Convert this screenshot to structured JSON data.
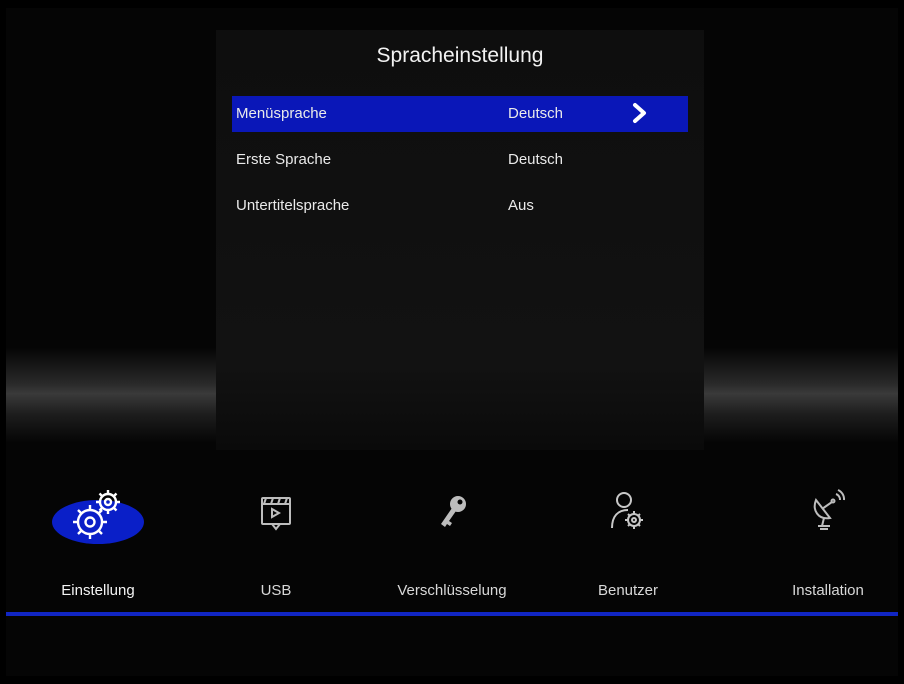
{
  "dialog": {
    "title": "Spracheinstellung",
    "rows": [
      {
        "label": "Menüsprache",
        "value": "Deutsch",
        "selected": true
      },
      {
        "label": "Erste Sprache",
        "value": "Deutsch",
        "selected": false
      },
      {
        "label": "Untertitelsprache",
        "value": "Aus",
        "selected": false
      }
    ]
  },
  "menu": {
    "items": [
      {
        "label": "Einstellung",
        "icon": "gears-icon",
        "active": true
      },
      {
        "label": "USB",
        "icon": "usb-media-icon",
        "active": false
      },
      {
        "label": "Verschlüsselung",
        "icon": "key-icon",
        "active": false
      },
      {
        "label": "Benutzer",
        "icon": "user-settings-icon",
        "active": false
      },
      {
        "label": "Installation",
        "icon": "satellite-dish-icon",
        "active": false
      }
    ]
  },
  "colors": {
    "highlight": "#0a17b8",
    "background": "#050505",
    "accent_line": "#1126c4"
  }
}
